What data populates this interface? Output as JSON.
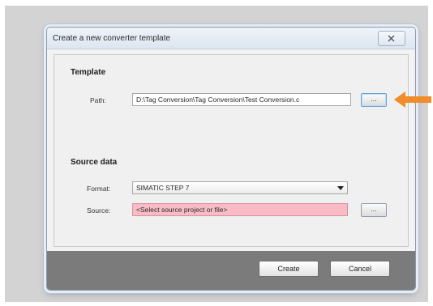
{
  "dialog": {
    "title": "Create a new converter template",
    "close_icon": "close-x-icon"
  },
  "template_section": {
    "heading": "Template",
    "path_label": "Path:",
    "path_value": "D:\\Tag Conversion\\Tag Conversion\\Test Conversion.c",
    "browse_label": "..."
  },
  "source_section": {
    "heading": "Source data",
    "format_label": "Format:",
    "format_value": "SIMATIC STEP 7",
    "source_label": "Source:",
    "source_placeholder": "<Select source project or file>",
    "browse_label": "..."
  },
  "footer": {
    "create_label": "Create",
    "cancel_label": "Cancel"
  },
  "colors": {
    "arrow": "#f08c2a",
    "error_field": "#f9bcc7"
  }
}
